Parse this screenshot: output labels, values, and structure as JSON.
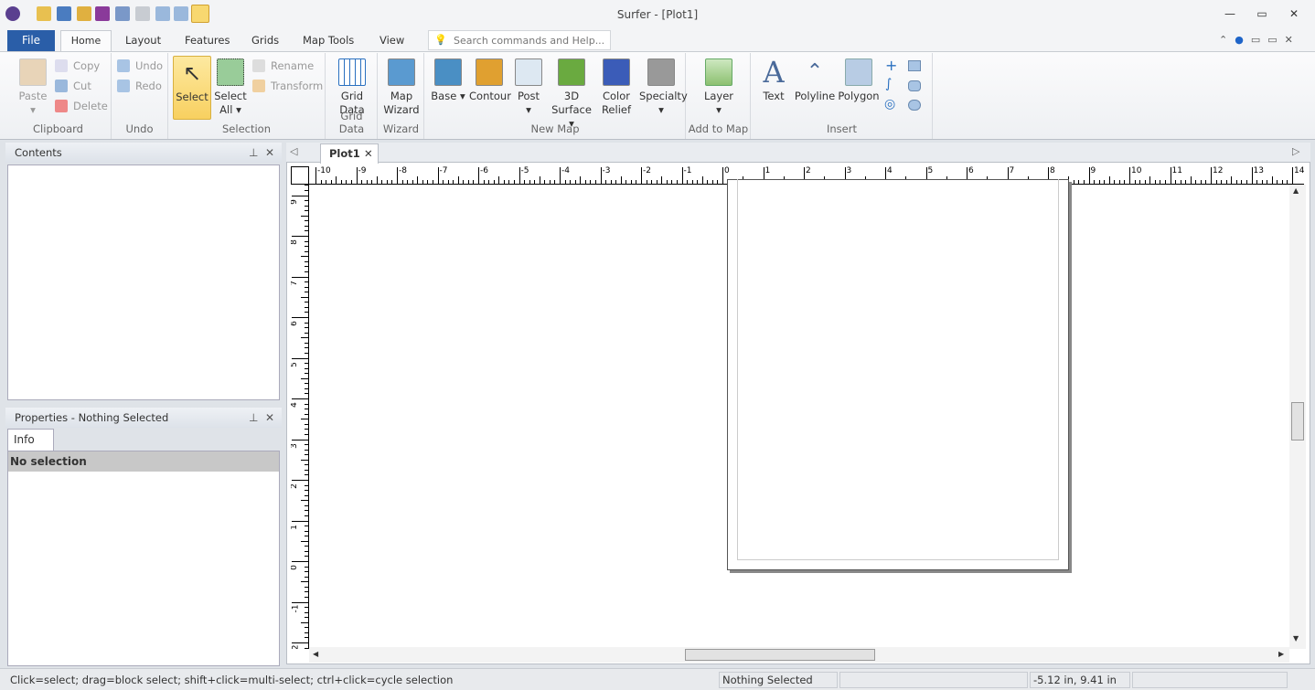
{
  "window": {
    "title": "Surfer - [Plot1]",
    "minimize": "—",
    "restore": "▭",
    "close": "✕"
  },
  "ribbon_tabs": [
    "File",
    "Home",
    "Layout",
    "Features",
    "Grids",
    "Map Tools",
    "View"
  ],
  "search": {
    "placeholder": "Search commands and Help..."
  },
  "clipboard": {
    "label": "Clipboard",
    "paste": "Paste",
    "copy": "Copy",
    "cut": "Cut",
    "delete": "Delete"
  },
  "undo": {
    "label": "Undo",
    "undo": "Undo",
    "redo": "Redo"
  },
  "selection": {
    "label": "Selection",
    "select": "Select",
    "select_all": "Select All ▾",
    "rename": "Rename",
    "transform": "Transform"
  },
  "grid_data": {
    "label": "Grid Data",
    "button": "Grid Data"
  },
  "wizard": {
    "label": "Wizard",
    "button": "Map Wizard"
  },
  "new_map": {
    "label": "New Map",
    "items": [
      {
        "label": "Base ▾",
        "color": "#4a8fc4"
      },
      {
        "label": "Contour",
        "color": "#e0a030"
      },
      {
        "label": "Post ▾",
        "color": "#dde8f2"
      },
      {
        "label": "3D Surface ▾",
        "color": "#6aaa40"
      },
      {
        "label": "Color Relief",
        "color": "#3b5cb8"
      },
      {
        "label": "Specialty ▾",
        "color": "#999999"
      }
    ]
  },
  "add_to_map": {
    "label": "Add to Map",
    "layer": "Layer ▾"
  },
  "insert": {
    "label": "Insert",
    "text": "Text",
    "polyline": "Polyline",
    "polygon": "Polygon"
  },
  "contents": {
    "title": "Contents"
  },
  "properties": {
    "title": "Properties - Nothing Selected",
    "tab": "Info",
    "header": "No selection"
  },
  "document": {
    "tab": "Plot1"
  },
  "rulers": {
    "h_labels": [
      -10,
      -9,
      -8,
      -7,
      -6,
      -5,
      -4,
      -3,
      -2,
      -1,
      0,
      1,
      2,
      3,
      4,
      5,
      6,
      7,
      8,
      9,
      10,
      11,
      12,
      13,
      14
    ],
    "v_labels": [
      9,
      8,
      7,
      6,
      5,
      4,
      3,
      2,
      1,
      0,
      -1,
      -2
    ]
  },
  "status": {
    "hint": "Click=select; drag=block select; shift+click=multi-select; ctrl+click=cycle selection",
    "selection": "Nothing Selected",
    "coords": "-5.12 in, 9.41 in"
  }
}
